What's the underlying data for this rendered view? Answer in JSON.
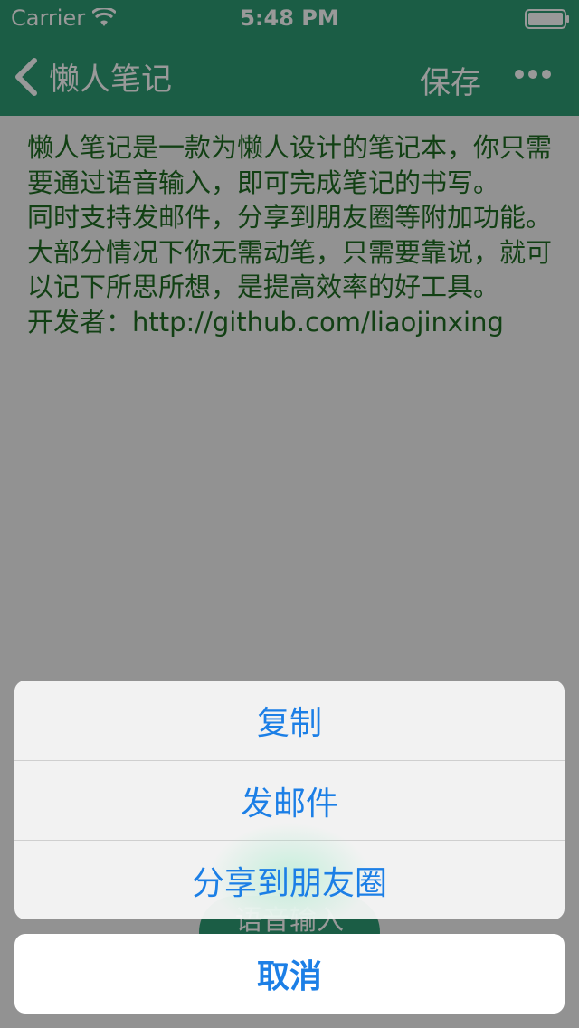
{
  "status_bar": {
    "carrier": "Carrier",
    "time": "5:48 PM"
  },
  "nav": {
    "back_label": "懒人笔记",
    "save_label": "保存",
    "more_icon": "ellipsis-icon",
    "color": "#2e9c73"
  },
  "note": {
    "text": "懒人笔记是一款为懒人设计的笔记本，你只需要通过语音输入，即可完成笔记的书写。\n同时支持发邮件，分享到朋友圈等附加功能。\n大部分情况下你无需动笔，只需要靠说，就可以记下所思所想，是提高效率的好工具。\n开发者：http://github.com/liaojinxing"
  },
  "voice_button": {
    "label": "语音输入"
  },
  "action_sheet": {
    "items": [
      {
        "label": "复制"
      },
      {
        "label": "发邮件"
      },
      {
        "label": "分享到朋友圈"
      }
    ],
    "cancel_label": "取消",
    "accent": "#1c7fe6"
  }
}
